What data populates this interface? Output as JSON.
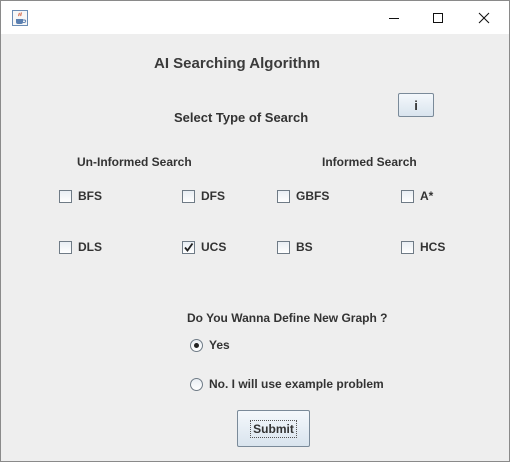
{
  "window": {
    "app_icon": "java-cup-icon",
    "minimize_icon": "minimize-icon",
    "maximize_icon": "maximize-icon",
    "close_icon": "close-icon"
  },
  "header": {
    "title": "AI Searching Algorithm",
    "subtitle": "Select Type of Search",
    "info_button_label": "i"
  },
  "groups": {
    "uninformed_label": "Un-Informed Search",
    "informed_label": "Informed Search"
  },
  "checkboxes": [
    {
      "label": "BFS",
      "checked": false
    },
    {
      "label": "DFS",
      "checked": false
    },
    {
      "label": "GBFS",
      "checked": false
    },
    {
      "label": "A*",
      "checked": false
    },
    {
      "label": "DLS",
      "checked": false
    },
    {
      "label": "UCS",
      "checked": true
    },
    {
      "label": "BS",
      "checked": false
    },
    {
      "label": "HCS",
      "checked": false
    }
  ],
  "graph_question": {
    "question": "Do You Wanna Define New Graph ?",
    "options": [
      {
        "label": "Yes",
        "selected": true
      },
      {
        "label": "No. I will use example problem",
        "selected": false
      }
    ]
  },
  "submit_label": "Submit"
}
